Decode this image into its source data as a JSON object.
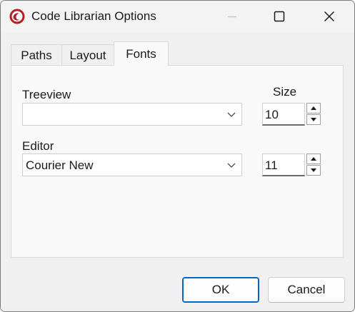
{
  "window": {
    "title": "Code Librarian Options"
  },
  "tabs": [
    {
      "label": "Paths"
    },
    {
      "label": "Layout"
    },
    {
      "label": "Fonts",
      "selected": true
    }
  ],
  "fonts_tab": {
    "treeview": {
      "label": "Treeview",
      "font_value": "",
      "size_value": "10"
    },
    "size_header": "Size",
    "editor": {
      "label": "Editor",
      "font_value": "Courier New",
      "size_value": "11"
    }
  },
  "buttons": {
    "ok": "OK",
    "cancel": "Cancel"
  },
  "colors": {
    "accent": "#0067c0",
    "app_icon": "#b3202a"
  }
}
